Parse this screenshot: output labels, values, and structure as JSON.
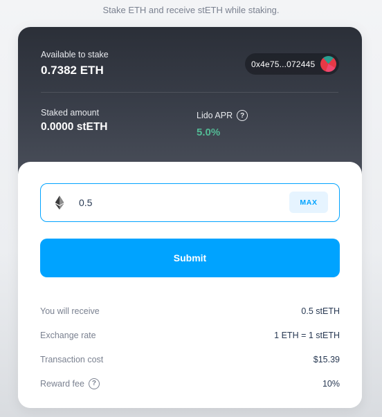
{
  "header": {
    "subtitle": "Stake ETH and receive stETH while staking."
  },
  "stats": {
    "available_label": "Available to stake",
    "available_value": "0.7382 ETH",
    "wallet_address": "0x4e75...072445",
    "staked_label": "Staked amount",
    "staked_value": "0.0000 stETH",
    "apr_label": "Lido APR",
    "apr_help_icon": "?",
    "apr_value": "5.0%"
  },
  "form": {
    "amount_value": "0.5",
    "token_icon": "eth-icon",
    "max_label": "MAX",
    "submit_label": "Submit"
  },
  "details": [
    {
      "label": "You will receive",
      "value": "0.5 stETH",
      "help": false
    },
    {
      "label": "Exchange rate",
      "value": "1 ETH = 1 stETH",
      "help": false
    },
    {
      "label": "Transaction cost",
      "value": "$15.39",
      "help": false
    },
    {
      "label": "Reward fee",
      "value": "10%",
      "help": true
    }
  ],
  "colors": {
    "accent": "#00a3ff",
    "apr_green": "#53ba95",
    "dark_panel": "#2b2f38"
  }
}
